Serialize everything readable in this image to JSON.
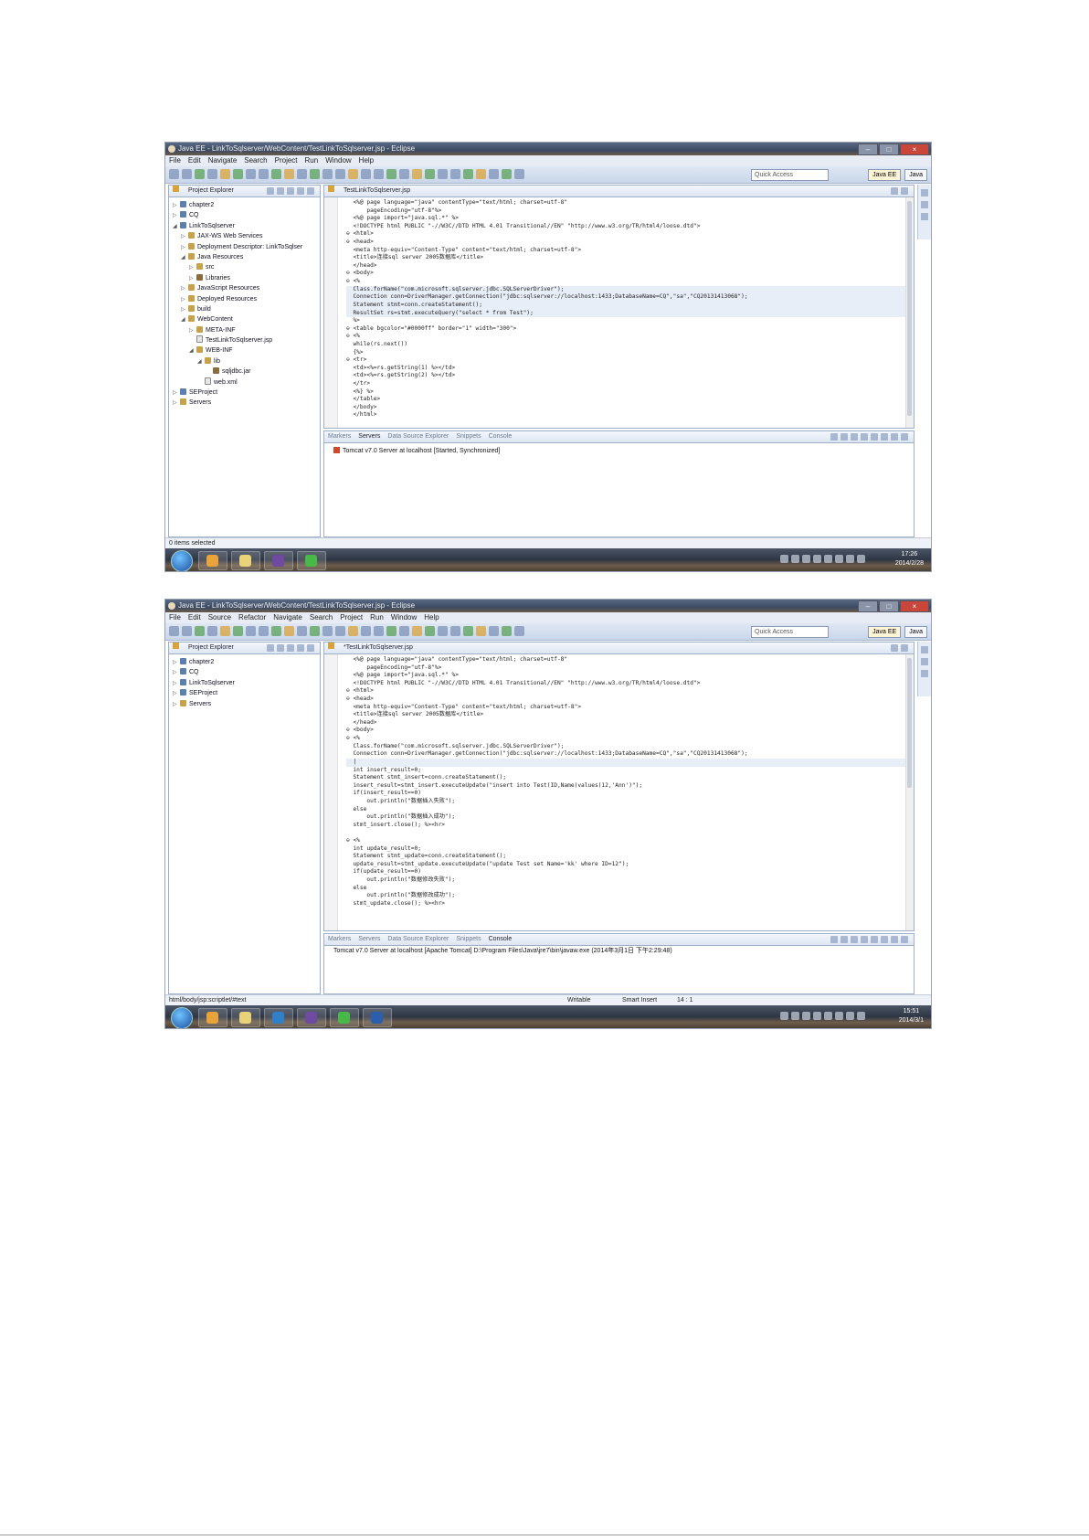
{
  "screenshots": [
    {
      "window_title": "Java EE - LinkToSqlserver/WebContent/TestLinkToSqlserver.jsp - Eclipse",
      "menu": [
        "File",
        "Edit",
        "Navigate",
        "Search",
        "Project",
        "Run",
        "Window",
        "Help"
      ],
      "quick_access": "Quick Access",
      "perspectives": [
        "Java EE",
        "Java"
      ],
      "explorer_title": "Project Explorer",
      "tree": [
        {
          "label": "chapter2",
          "depth": 0,
          "arrow": "▷",
          "icon": "proj"
        },
        {
          "label": "CQ",
          "depth": 0,
          "arrow": "▷",
          "icon": "proj"
        },
        {
          "label": "LinkToSqlserver",
          "depth": 0,
          "arrow": "◢",
          "icon": "proj"
        },
        {
          "label": "JAX-WS Web Services",
          "depth": 1,
          "arrow": "▷",
          "icon": "folder"
        },
        {
          "label": "Deployment Descriptor: LinkToSqlser",
          "depth": 1,
          "arrow": "▷",
          "icon": "folder"
        },
        {
          "label": "Java Resources",
          "depth": 1,
          "arrow": "◢",
          "icon": "folder"
        },
        {
          "label": "src",
          "depth": 2,
          "arrow": "▷",
          "icon": "folder"
        },
        {
          "label": "Libraries",
          "depth": 2,
          "arrow": "▷",
          "icon": "jar"
        },
        {
          "label": "JavaScript Resources",
          "depth": 1,
          "arrow": "▷",
          "icon": "folder"
        },
        {
          "label": "Deployed Resources",
          "depth": 1,
          "arrow": "▷",
          "icon": "folder"
        },
        {
          "label": "build",
          "depth": 1,
          "arrow": "▷",
          "icon": "folder"
        },
        {
          "label": "WebContent",
          "depth": 1,
          "arrow": "◢",
          "icon": "folder"
        },
        {
          "label": "META-INF",
          "depth": 2,
          "arrow": "▷",
          "icon": "folder"
        },
        {
          "label": "TestLinkToSqlserver.jsp",
          "depth": 2,
          "arrow": "",
          "icon": "file"
        },
        {
          "label": "WEB-INF",
          "depth": 2,
          "arrow": "◢",
          "icon": "folder"
        },
        {
          "label": "lib",
          "depth": 3,
          "arrow": "◢",
          "icon": "folder"
        },
        {
          "label": "sqljdbc.jar",
          "depth": 4,
          "arrow": "",
          "icon": "jar"
        },
        {
          "label": "web.xml",
          "depth": 3,
          "arrow": "",
          "icon": "file"
        },
        {
          "label": "SEProject",
          "depth": 0,
          "arrow": "▷",
          "icon": "proj"
        },
        {
          "label": "Servers",
          "depth": 0,
          "arrow": "▷",
          "icon": "folder"
        }
      ],
      "editor_tab": "TestLinkToSqlserver.jsp",
      "code": [
        "  <%@ page language=\"java\" contentType=\"text/html; charset=utf-8\"",
        "      pageEncoding=\"utf-8\"%>",
        "  <%@ page import=\"java.sql.*\" %>",
        "  <!DOCTYPE html PUBLIC \"-//W3C//DTD HTML 4.01 Transitional//EN\" \"http://www.w3.org/TR/html4/loose.dtd\">",
        "⊖ <html>",
        "⊖ <head>",
        "  <meta http-equiv=\"Content-Type\" content=\"text/html; charset=utf-8\">",
        "  <title>连接sql server 2005数据库</title>",
        "  </head>",
        "⊖ <body>",
        "⊖ <%",
        "  Class.forName(\"com.microsoft.sqlserver.jdbc.SQLServerDriver\");",
        "  Connection conn=DriverManager.getConnection(\"jdbc:sqlserver://localhost:1433;DatabaseName=CQ\",\"sa\",\"CQ20131413068\");",
        "  Statement stmt=conn.createStatement();",
        "  ResultSet rs=stmt.executeQuery(\"select * from Test\");",
        "  %>",
        "⊖ <table bgcolor=\"#0000ff\" border=\"1\" width=\"300\">",
        "⊖ <%",
        "  while(rs.next())",
        "  {%>",
        "⊖ <tr>",
        "  <td><%=rs.getString(1) %></td>",
        "  <td><%=rs.getString(2) %></td>",
        "  </tr>",
        "  <%} %>",
        "  </table>",
        "  </body>",
        "  </html>"
      ],
      "bottom_tabs": [
        "Markers",
        "Servers",
        "Data Source Explorer",
        "Snippets",
        "Console"
      ],
      "bottom_active": "Servers",
      "bottom_lines": [
        "Tomcat v7.0 Server at localhost  [Started, Synchronized]"
      ],
      "status_left": "0 items selected",
      "status_mid": "",
      "status_pos": "",
      "clock_time": "17:26",
      "clock_date": "2014/2/28"
    },
    {
      "window_title": "Java EE - LinkToSqlserver/WebContent/TestLinkToSqlserver.jsp - Eclipse",
      "menu": [
        "File",
        "Edit",
        "Source",
        "Refactor",
        "Navigate",
        "Search",
        "Project",
        "Run",
        "Window",
        "Help"
      ],
      "quick_access": "Quick Access",
      "perspectives": [
        "Java EE",
        "Java"
      ],
      "explorer_title": "Project Explorer",
      "tree": [
        {
          "label": "chapter2",
          "depth": 0,
          "arrow": "▷",
          "icon": "proj"
        },
        {
          "label": "CQ",
          "depth": 0,
          "arrow": "▷",
          "icon": "proj"
        },
        {
          "label": "LinkToSqlserver",
          "depth": 0,
          "arrow": "▷",
          "icon": "proj"
        },
        {
          "label": "SEProject",
          "depth": 0,
          "arrow": "▷",
          "icon": "proj"
        },
        {
          "label": "Servers",
          "depth": 0,
          "arrow": "▷",
          "icon": "folder"
        }
      ],
      "editor_tab": "*TestLinkToSqlserver.jsp",
      "code": [
        "  <%@ page language=\"java\" contentType=\"text/html; charset=utf-8\"",
        "      pageEncoding=\"utf-8\"%>",
        "  <%@ page import=\"java.sql.*\" %>",
        "  <!DOCTYPE html PUBLIC \"-//W3C//DTD HTML 4.01 Transitional//EN\" \"http://www.w3.org/TR/html4/loose.dtd\">",
        "⊖ <html>",
        "⊖ <head>",
        "  <meta http-equiv=\"Content-Type\" content=\"text/html; charset=utf-8\">",
        "  <title>连接sql server 2005数据库</title>",
        "  </head>",
        "⊖ <body>",
        "⊖ <%",
        "  Class.forName(\"com.microsoft.sqlserver.jdbc.SQLServerDriver\");",
        "  Connection conn=DriverManager.getConnection(\"jdbc:sqlserver://localhost:1433;DatabaseName=CQ\",\"sa\",\"CQ20131413068\");",
        "  |",
        "  int insert_result=0;",
        "  Statement stmt_insert=conn.createStatement();",
        "  insert_result=stmt_insert.executeUpdate(\"insert into Test(ID,Name)values(12,'Ann')\");",
        "  if(insert_result==0)",
        "      out.println(\"数据插入失败\");",
        "  else",
        "      out.println(\"数据插入成功\");",
        "  stmt_insert.close(); %><hr>",
        "",
        "⊖ <%",
        "  int update_result=0;",
        "  Statement stmt_update=conn.createStatement();",
        "  update_result=stmt_update.executeUpdate(\"update Test set Name='kk' where ID=12\");",
        "  if(update_result==0)",
        "      out.println(\"数据修改失败\");",
        "  else",
        "      out.println(\"数据修改成功\");",
        "  stmt_update.close(); %><hr>"
      ],
      "bottom_tabs": [
        "Markers",
        "Servers",
        "Data Source Explorer",
        "Snippets",
        "Console"
      ],
      "bottom_active": "Console",
      "bottom_lines": [
        "Tomcat v7.0 Server at localhost [Apache Tomcat] D:\\Program Files\\Java\\jre7\\bin\\javaw.exe (2014年3月1日 下午2:29:48)"
      ],
      "status_left": "html/body/jsp:scriptlet/#text",
      "status_mid": "Writable",
      "status_mid2": "Smart Insert",
      "status_pos": "14 : 1",
      "clock_time": "15:51",
      "clock_date": "2014/3/1"
    }
  ],
  "colors": {
    "accent": "#3b4a63",
    "editor_bg": "#ffffff",
    "taskbar": "#2e3644"
  }
}
